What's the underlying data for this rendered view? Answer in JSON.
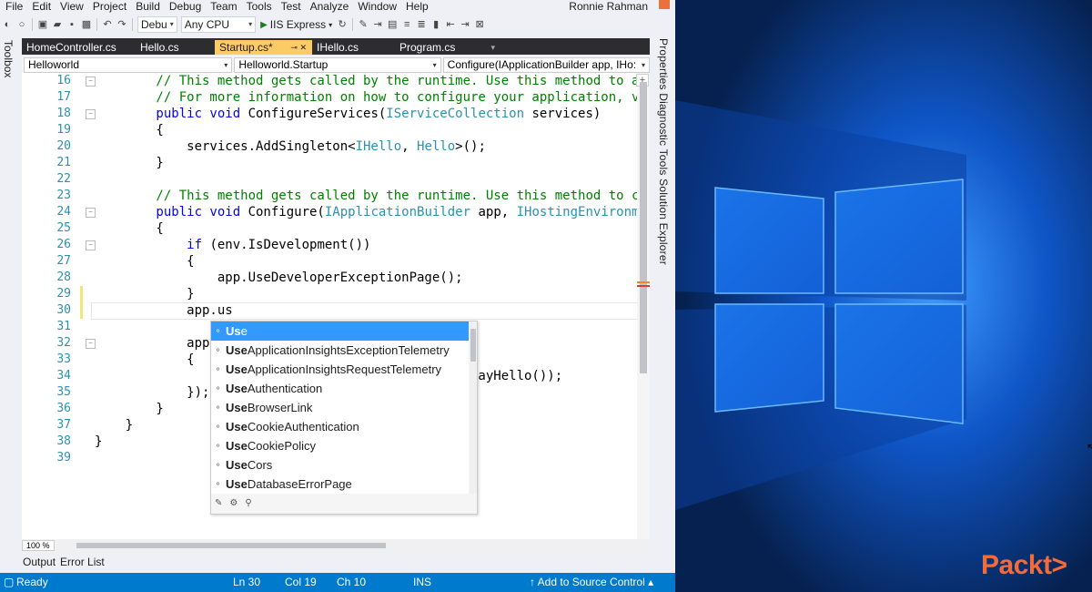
{
  "menu": [
    "File",
    "Edit",
    "View",
    "Project",
    "Build",
    "Debug",
    "Team",
    "Tools",
    "Test",
    "Analyze",
    "Window",
    "Help"
  ],
  "user": "Ronnie Rahman",
  "toolbar": {
    "config": "Debu",
    "platform": "Any CPU",
    "run_target": "IIS Express"
  },
  "side_left": "Toolbox",
  "side_right": "Properties  Diagnostic Tools  Solution Explorer",
  "tabs": [
    "HomeController.cs",
    "Hello.cs",
    "Startup.cs*",
    "IHello.cs",
    "Program.cs"
  ],
  "active_tab": "Startup.cs*",
  "nav": {
    "project": "Helloworld",
    "class": "Helloworld.Startup",
    "member": "Configure(IApplicationBuilder app, IHo:"
  },
  "line_numbers": [
    "16",
    "17",
    "18",
    "19",
    "20",
    "21",
    "22",
    "23",
    "24",
    "25",
    "26",
    "27",
    "28",
    "29",
    "30",
    "31",
    "32",
    "33",
    "34",
    "35",
    "36",
    "37",
    "38",
    "39"
  ],
  "code": [
    {
      "i": 0,
      "parts": [
        [
          "cm",
          "        // This method gets called by the runtime. Use this method to add"
        ]
      ]
    },
    {
      "i": 1,
      "parts": [
        [
          "cm",
          "        // For more information on how to configure your application, visi"
        ]
      ]
    },
    {
      "i": 2,
      "parts": [
        [
          "kw",
          "        public void "
        ],
        [
          "",
          "ConfigureServices("
        ],
        [
          "ty",
          "IServiceCollection"
        ],
        [
          "",
          " services)"
        ]
      ]
    },
    {
      "i": 3,
      "parts": [
        [
          "",
          "        {"
        ]
      ]
    },
    {
      "i": 4,
      "parts": [
        [
          "",
          "            services.AddSingleton<"
        ],
        [
          "ty",
          "IHello"
        ],
        [
          "",
          ", "
        ],
        [
          "ty",
          "Hello"
        ],
        [
          "",
          ">();"
        ]
      ]
    },
    {
      "i": 5,
      "parts": [
        [
          "",
          "        }"
        ]
      ]
    },
    {
      "i": 7,
      "parts": [
        [
          "cm",
          "        // This method gets called by the runtime. Use this method to conf"
        ]
      ]
    },
    {
      "i": 8,
      "parts": [
        [
          "kw",
          "        public void "
        ],
        [
          "",
          "Configure("
        ],
        [
          "ty",
          "IApplicationBuilder"
        ],
        [
          "",
          " app, "
        ],
        [
          "ty",
          "IHostingEnvironment"
        ]
      ]
    },
    {
      "i": 9,
      "parts": [
        [
          "",
          "        {"
        ]
      ]
    },
    {
      "i": 10,
      "parts": [
        [
          "kw",
          "            if "
        ],
        [
          "",
          "(env.IsDevelopment())"
        ]
      ]
    },
    {
      "i": 11,
      "parts": [
        [
          "",
          "            {"
        ]
      ]
    },
    {
      "i": 12,
      "parts": [
        [
          "",
          "                app.UseDeveloperExceptionPage();"
        ]
      ]
    },
    {
      "i": 13,
      "parts": [
        [
          "",
          "            }"
        ]
      ]
    },
    {
      "i": 14,
      "parts": [
        [
          "",
          "            app.us"
        ]
      ]
    },
    {
      "i": 16,
      "parts": [
        [
          "",
          "            app."
        ]
      ]
    },
    {
      "i": 17,
      "parts": [
        [
          "",
          "            {"
        ]
      ]
    },
    {
      "i": 18,
      "parts": [
        [
          "",
          "                                             llo.sayHello());"
        ]
      ]
    },
    {
      "i": 19,
      "parts": [
        [
          "",
          "            });"
        ]
      ]
    },
    {
      "i": 20,
      "parts": [
        [
          "",
          "        }"
        ]
      ]
    },
    {
      "i": 21,
      "parts": [
        [
          "",
          "    }"
        ]
      ]
    },
    {
      "i": 22,
      "parts": [
        [
          "",
          "}"
        ]
      ]
    }
  ],
  "completion": {
    "typed": "Us",
    "items": [
      {
        "bold": "Us",
        "rest": "e"
      },
      {
        "bold": "Use",
        "rest": "ApplicationInsightsExceptionTelemetry"
      },
      {
        "bold": "Use",
        "rest": "ApplicationInsightsRequestTelemetry"
      },
      {
        "bold": "Use",
        "rest": "Authentication"
      },
      {
        "bold": "Use",
        "rest": "BrowserLink"
      },
      {
        "bold": "Use",
        "rest": "CookieAuthentication"
      },
      {
        "bold": "Use",
        "rest": "CookiePolicy"
      },
      {
        "bold": "Use",
        "rest": "Cors"
      },
      {
        "bold": "Use",
        "rest": "DatabaseErrorPage"
      }
    ],
    "selected_index": 0
  },
  "zoom": "100 %",
  "bottom_tabs": [
    "Output",
    "Error List"
  ],
  "status": {
    "state": "Ready",
    "ln": "Ln 30",
    "col": "Col 19",
    "ch": "Ch 10",
    "mode": "INS",
    "source_control": "↑ Add to Source Control ▴"
  },
  "brand": "Packt>",
  "colors": {
    "status_bar": "#007acc",
    "active_tab": "#fcca66",
    "comment": "#008000",
    "keyword": "#0000ff",
    "type": "#2b91af",
    "completion_selected": "#3399ff",
    "brand": "#f26b3a"
  }
}
